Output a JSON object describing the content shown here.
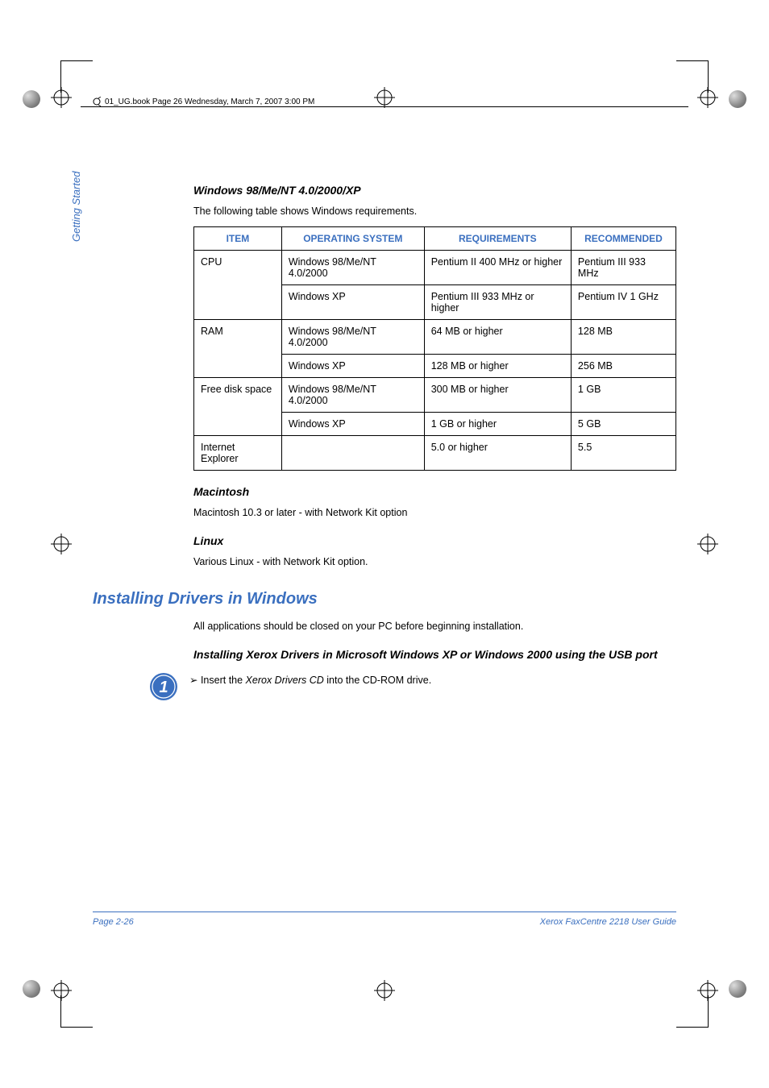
{
  "header": {
    "filestamp": "01_UG.book  Page 26  Wednesday, March 7, 2007  3:00 PM"
  },
  "side_label": "Getting Started",
  "windows_section": {
    "heading": "Windows 98/Me/NT 4.0/2000/XP",
    "intro": "The following table shows Windows requirements.",
    "columns": [
      "ITEM",
      "OPERATING SYSTEM",
      "REQUIREMENTS",
      "RECOMMENDED"
    ],
    "rows": [
      {
        "item": "CPU",
        "os": "Windows 98/Me/NT 4.0/2000",
        "req": "Pentium II 400 MHz or higher",
        "rec": "Pentium III 933 MHz"
      },
      {
        "item": "",
        "os": "Windows XP",
        "req": "Pentium III 933 MHz or higher",
        "rec": "Pentium IV 1 GHz"
      },
      {
        "item": "RAM",
        "os": "Windows 98/Me/NT 4.0/2000",
        "req": "64 MB or higher",
        "rec": "128 MB"
      },
      {
        "item": "",
        "os": "Windows XP",
        "req": "128 MB or higher",
        "rec": "256 MB"
      },
      {
        "item": "Free disk space",
        "os": "Windows 98/Me/NT 4.0/2000",
        "req": "300 MB or higher",
        "rec": "1 GB"
      },
      {
        "item": "",
        "os": "Windows XP",
        "req": "1 GB or higher",
        "rec": "5 GB"
      },
      {
        "item": "Internet Explorer",
        "os": "",
        "req": "5.0 or higher",
        "rec": "5.5"
      }
    ]
  },
  "mac_section": {
    "heading": "Macintosh",
    "text": "Macintosh 10.3 or later - with Network Kit option"
  },
  "linux_section": {
    "heading": "Linux",
    "text": "Various Linux - with Network Kit option."
  },
  "install_section": {
    "heading": "Installing Drivers in Windows",
    "intro": "All applications should be closed on your PC before beginning installation.",
    "sub_heading": "Installing Xerox Drivers in Microsoft Windows XP or Windows 2000 using the USB port",
    "step1_number": "1",
    "step1_prefix": "Insert the ",
    "step1_em": "Xerox Drivers CD",
    "step1_suffix": " into the CD-ROM drive."
  },
  "footer": {
    "left": "Page 2-26",
    "right": "Xerox FaxCentre 2218 User Guide"
  }
}
